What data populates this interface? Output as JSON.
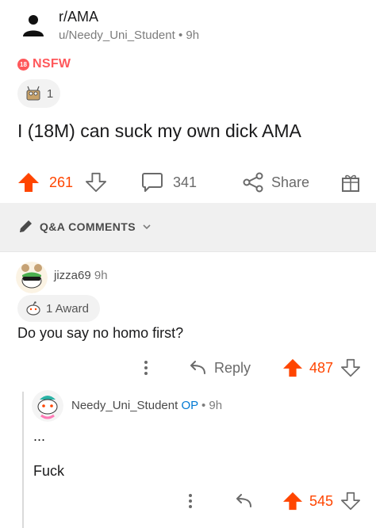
{
  "post": {
    "subreddit": "r/AMA",
    "author_line": "u/Needy_Uni_Student • 9h",
    "nsfw_badge": "18",
    "nsfw_label": "NSFW",
    "award_count": "1",
    "title": "I (18M) can suck my own dick AMA",
    "upvotes": "261",
    "comments": "341",
    "share_label": "Share"
  },
  "qa": {
    "label": "Q&A COMMENTS"
  },
  "comment1": {
    "username": "jizza69",
    "time": "9h",
    "award_label": "1 Award",
    "body": "Do you say no homo first?",
    "reply_label": "Reply",
    "score": "487"
  },
  "comment2": {
    "username": "Needy_Uni_Student",
    "op_label": "OP",
    "time_sep": " • 9h",
    "line1": "...",
    "line2": "Fuck",
    "score": "545"
  },
  "colors": {
    "upvote": "#ff4500",
    "op": "#0079d3",
    "nsfw": "#ff585b"
  },
  "icons": [
    "user-icon",
    "upvote-arrow-icon",
    "downvote-arrow-icon",
    "comment-bubble-icon",
    "share-icon",
    "gift-icon",
    "pencil-icon",
    "chevron-down-icon",
    "award-icon",
    "more-vertical-icon",
    "reply-arrow-icon"
  ]
}
